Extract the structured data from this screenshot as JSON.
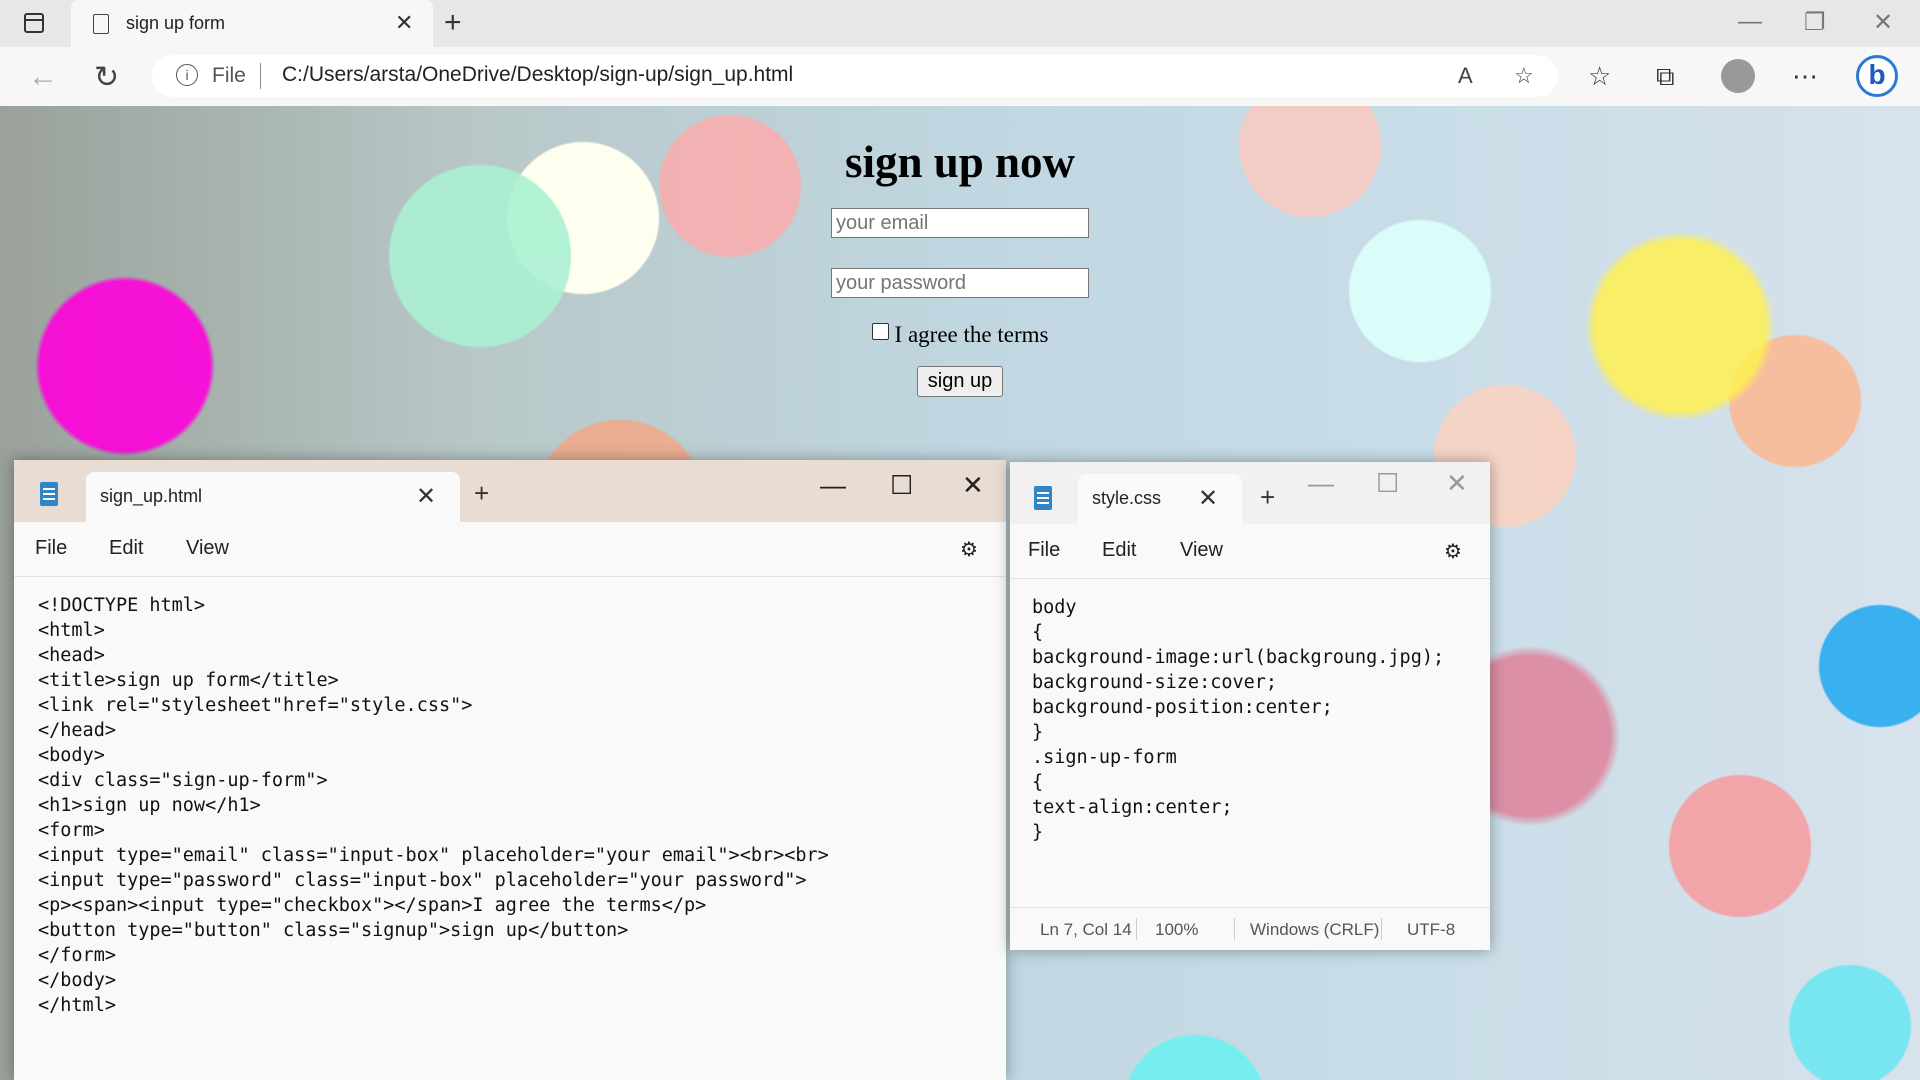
{
  "browser": {
    "tab_title": "sign up form",
    "address_prefix": "File",
    "url": "C:/Users/arsta/OneDrive/Desktop/sign-up/sign_up.html"
  },
  "page": {
    "heading": "sign up now",
    "email_placeholder": "your email",
    "password_placeholder": "your password",
    "agree_text": "I agree the terms",
    "signup_button": "sign up"
  },
  "notepad_html": {
    "tab_title": "sign_up.html",
    "menu": [
      "File",
      "Edit",
      "View"
    ],
    "code": "<!DOCTYPE html>\n<html>\n<head>\n<title>sign up form</title>\n<link rel=\"stylesheet\"href=\"style.css\">\n</head>\n<body>\n<div class=\"sign-up-form\">\n<h1>sign up now</h1>\n<form>\n<input type=\"email\" class=\"input-box\" placeholder=\"your email\"><br><br>\n<input type=\"password\" class=\"input-box\" placeholder=\"your password\">\n<p><span><input type=\"checkbox\"></span>I agree the terms</p>\n<button type=\"button\" class=\"signup\">sign up</button>\n</form>\n</body>\n</html>"
  },
  "notepad_css": {
    "tab_title": "style.css",
    "menu": [
      "File",
      "Edit",
      "View"
    ],
    "code": "body\n{\nbackground-image:url(backgroung.jpg);\nbackground-size:cover;\nbackground-position:center;\n}\n.sign-up-form\n{\ntext-align:center;\n}",
    "status": {
      "position": "Ln 7, Col 14",
      "zoom": "100%",
      "line_ending": "Windows (CRLF)",
      "encoding": "UTF-8"
    }
  }
}
